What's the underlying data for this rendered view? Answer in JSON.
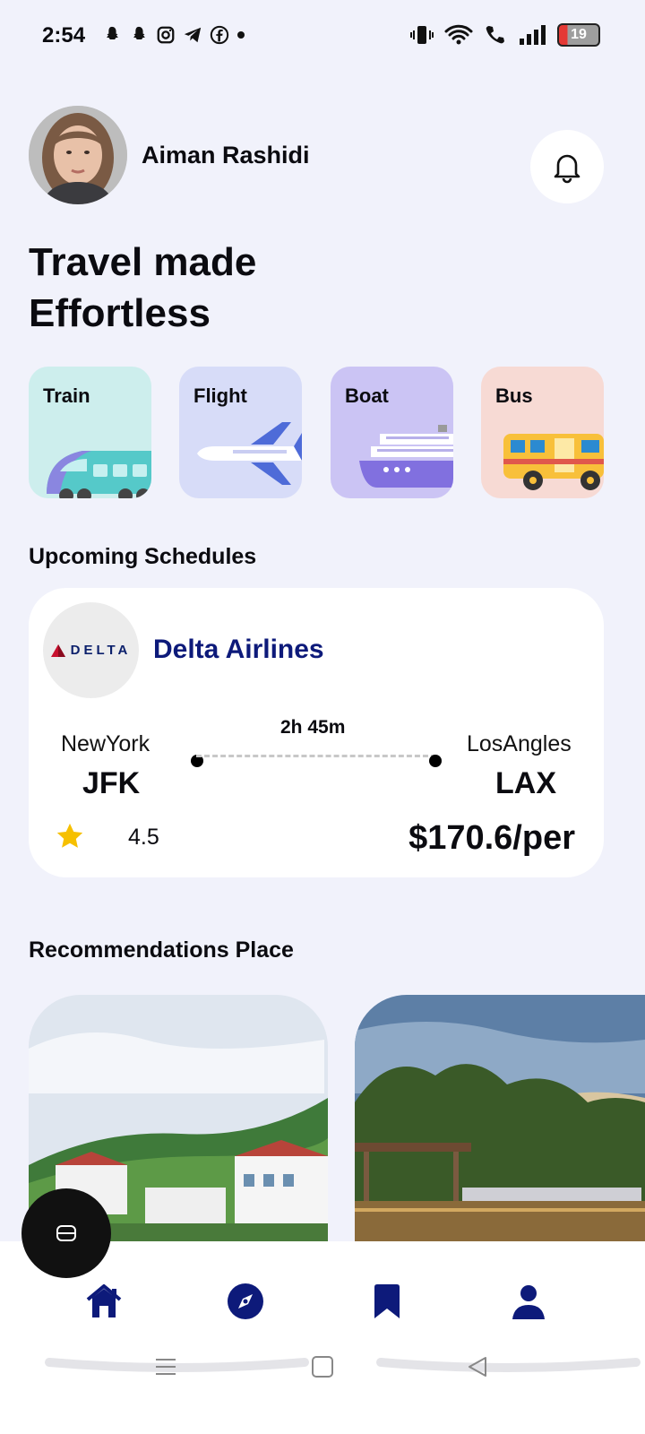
{
  "status_bar": {
    "time": "2:54",
    "battery": "19"
  },
  "header": {
    "user_name": "Aiman Rashidi"
  },
  "headline": "Travel made Effortless",
  "categories": [
    {
      "label": "Train",
      "color": "#cdeeed"
    },
    {
      "label": "Flight",
      "color": "#d7dcf8"
    },
    {
      "label": "Boat",
      "color": "#cbc4f4"
    },
    {
      "label": "Bus",
      "color": "#f7dad4"
    }
  ],
  "upcoming": {
    "title": "Upcoming Schedules",
    "airline_logo": "DELTA",
    "airline_name": "Delta Airlines",
    "duration": "2h 45m",
    "from_city": "NewYork",
    "from_code": "JFK",
    "to_city": "LosAngles",
    "to_code": "LAX",
    "rating": "4.5",
    "price": "$170.6/per"
  },
  "recommendations": {
    "title": "Recommendations Place"
  },
  "nav": {
    "items": [
      "home-icon",
      "compass-icon",
      "bookmark-icon",
      "profile-icon"
    ],
    "active_color": "#0d1a7a"
  }
}
